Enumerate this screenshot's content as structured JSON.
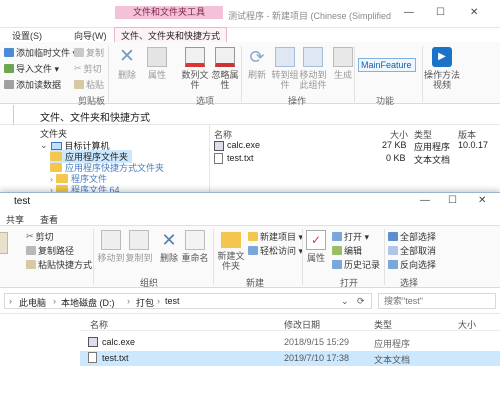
{
  "back_window": {
    "context_tab": "文件和文件夹工具",
    "title": "测试程序 - 新建项目 (Chinese (Simplified",
    "tabs": [
      "设置(S)",
      "向导(W)",
      "文件、文件夹和快捷方式"
    ],
    "ribbon": {
      "left_items": [
        "添加临时文件 ▾",
        "导入文件 ▾",
        "添加读数据"
      ],
      "clipboard_items": [
        "复制",
        "剪切",
        "粘贴"
      ],
      "clipboard_group": "剪贴板",
      "big_buttons": [
        "删除",
        "属性",
        "数列文件",
        "忽略属性",
        "刷新",
        "转到组件",
        "移动到此组件",
        "生成"
      ],
      "options_group": "选项",
      "operate_group": "操作",
      "feature_label": "MainFeature",
      "feature_group": "功能",
      "help_label": "操作方法视频"
    },
    "address": "文件、文件夹和快捷方式",
    "nav": {
      "header": "文件夹",
      "items": [
        "目标计算机",
        "应用程序文件夹",
        "应用程序快捷方式文件夹",
        "程序文件",
        "程序文件 64"
      ]
    },
    "list": {
      "columns": [
        "名称",
        "大小",
        "类型",
        "版本"
      ],
      "rows": [
        {
          "name": "calc.exe",
          "size": "27 KB",
          "type": "应用程序",
          "version": "10.0.17"
        },
        {
          "name": "test.txt",
          "size": "0 KB",
          "type": "文本文档",
          "version": ""
        }
      ]
    }
  },
  "front_window": {
    "title": "test",
    "tabs": [
      "共享",
      "查看"
    ],
    "ribbon": {
      "clipboard_items": [
        "剪切",
        "复制路径",
        "粘贴快捷方式"
      ],
      "organize_buttons": [
        "移动到",
        "复制到",
        "删除",
        "重命名"
      ],
      "organize_group": "组织",
      "new_items": [
        "新建项目 ▾",
        "轻松访问 ▾"
      ],
      "new_folder": "新建文件夹",
      "new_group": "新建",
      "open_items": [
        "打开 ▾",
        "编辑",
        "历史记录"
      ],
      "properties": "属性",
      "open_group": "打开",
      "select_items": [
        "全部选择",
        "全部取消",
        "反向选择"
      ],
      "select_group": "选择"
    },
    "address": {
      "crumbs": [
        "此电脑",
        "本地磁盘 (D:)",
        "打包",
        "test"
      ],
      "search_placeholder": "搜索\"test\""
    },
    "list": {
      "columns": [
        "名称",
        "修改日期",
        "类型",
        "大小"
      ],
      "rows": [
        {
          "name": "calc.exe",
          "date": "2018/9/15 15:29",
          "type": "应用程序"
        },
        {
          "name": "test.txt",
          "date": "2019/7/10 17:38",
          "type": "文本文档"
        }
      ]
    },
    "left_label": "s"
  },
  "colors": {
    "context_tab": "#f4c2d8",
    "selection": "#cce8ff",
    "folder": "#f3c74d",
    "accent": "#1a73c7"
  }
}
